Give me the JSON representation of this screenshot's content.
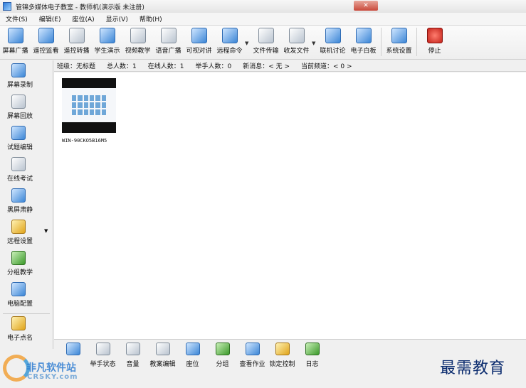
{
  "window": {
    "title": "管锦多媒体电子教室 - 教师机(演示版 未注册)",
    "close_glyph": "✕"
  },
  "menu": [
    "文件(S)",
    "编辑(E)",
    "座位(A)",
    "显示(V)",
    "帮助(H)"
  ],
  "toolbar": [
    {
      "label": "屏幕广播",
      "icon": "screen-broadcast-icon"
    },
    {
      "label": "遥控监看",
      "icon": "remote-monitor-icon"
    },
    {
      "label": "遥控转播",
      "icon": "remote-relay-icon"
    },
    {
      "label": "学生演示",
      "icon": "student-demo-icon"
    },
    {
      "label": "视频教学",
      "icon": "video-teaching-icon"
    },
    {
      "label": "语音广播",
      "icon": "voice-broadcast-icon"
    },
    {
      "label": "可视对讲",
      "icon": "video-intercom-icon"
    },
    {
      "label": "远程命令",
      "icon": "remote-command-icon"
    },
    {
      "label": "文件传输",
      "icon": "file-transfer-icon"
    },
    {
      "label": "收发文件",
      "icon": "send-receive-files-icon"
    },
    {
      "label": "联机讨论",
      "icon": "online-discussion-icon"
    },
    {
      "label": "电子白板",
      "icon": "whiteboard-icon"
    },
    {
      "label": "系统设置",
      "icon": "system-settings-icon"
    },
    {
      "label": "停止",
      "icon": "stop-icon"
    }
  ],
  "sidebar": [
    {
      "label": "屏幕录制",
      "icon": "screen-record-icon"
    },
    {
      "label": "屏幕回放",
      "icon": "screen-playback-icon"
    },
    {
      "label": "试题编辑",
      "icon": "quiz-edit-icon"
    },
    {
      "label": "在线考试",
      "icon": "online-exam-icon"
    },
    {
      "label": "黑屏肃静",
      "icon": "black-screen-icon"
    },
    {
      "label": "远程设置",
      "icon": "remote-settings-icon"
    },
    {
      "label": "分组教学",
      "icon": "group-teaching-icon"
    },
    {
      "label": "电脑配置",
      "icon": "computer-config-icon"
    },
    {
      "label": "电子点名",
      "icon": "roll-call-icon"
    }
  ],
  "status": {
    "class_label": "班级：无标题",
    "total_label": "总人数：1",
    "online_label": "在线人数：1",
    "hands_label": "举手人数：0",
    "message_label": "新消息：< 无 >",
    "channel_label": "当前频道：< 0 >"
  },
  "students": [
    {
      "name": "WIN-90CKO5B16M5"
    }
  ],
  "bottombar": [
    {
      "label": "",
      "icon": "message-icon"
    },
    {
      "label": "举手状态",
      "icon": "raise-hand-icon"
    },
    {
      "label": "音量",
      "icon": "volume-icon"
    },
    {
      "label": "教案编辑",
      "icon": "lesson-plan-icon"
    },
    {
      "label": "座位",
      "icon": "seat-icon"
    },
    {
      "label": "分组",
      "icon": "group-icon"
    },
    {
      "label": "查看作业",
      "icon": "homework-icon"
    },
    {
      "label": "锁定控制",
      "icon": "lock-control-icon"
    },
    {
      "label": "日志",
      "icon": "log-icon"
    }
  ],
  "watermark": {
    "left_cn": "非凡软件站",
    "left_en": "CRSKY.com",
    "right": "最需教育"
  }
}
